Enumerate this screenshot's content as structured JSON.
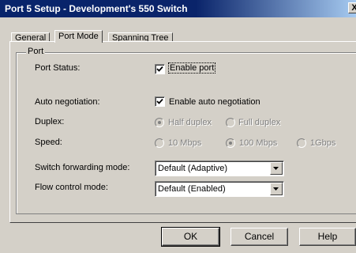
{
  "window": {
    "title": "Port 5 Setup - Development's 550 Switch",
    "close_label": "X"
  },
  "tabs": [
    {
      "label": "General"
    },
    {
      "label": "Port Mode"
    },
    {
      "label": "Spanning Tree"
    }
  ],
  "group": {
    "title": "Port"
  },
  "port_status": {
    "label": "Port Status:",
    "checkbox_label": "Enable port",
    "checked": true
  },
  "auto_negotiation": {
    "label": "Auto negotiation:",
    "checkbox_label": "Enable auto negotiation",
    "checked": true
  },
  "duplex": {
    "label": "Duplex:",
    "options": [
      "Half duplex",
      "Full duplex"
    ],
    "selected": "Half duplex"
  },
  "speed": {
    "label": "Speed:",
    "options": [
      "10 Mbps",
      "100 Mbps",
      "1Gbps"
    ],
    "selected": "100 Mbps"
  },
  "forwarding": {
    "label": "Switch forwarding mode:",
    "value": "Default (Adaptive)"
  },
  "flow_control": {
    "label": "Flow control mode:",
    "value": "Default (Enabled)"
  },
  "buttons": {
    "ok": "OK",
    "cancel": "Cancel",
    "help": "Help"
  },
  "colors": {
    "face": "#d4d0c8",
    "title_start": "#0a246a",
    "title_end": "#a6caf0"
  }
}
